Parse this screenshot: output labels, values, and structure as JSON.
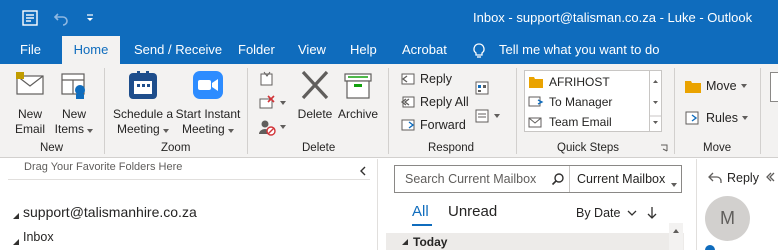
{
  "window": {
    "title": "Inbox - support@talisman.co.za - Luke  -  Outlook"
  },
  "tabs": [
    {
      "label": "File"
    },
    {
      "label": "Home"
    },
    {
      "label": "Send / Receive"
    },
    {
      "label": "Folder"
    },
    {
      "label": "View"
    },
    {
      "label": "Help"
    },
    {
      "label": "Acrobat"
    }
  ],
  "tell_me": "Tell me what you want to do",
  "ribbon": {
    "new": {
      "new_email": [
        "New",
        "Email"
      ],
      "new_items": [
        "New",
        "Items"
      ],
      "label": "New"
    },
    "zoom": {
      "schedule": [
        "Schedule a",
        "Meeting"
      ],
      "instant": [
        "Start Instant",
        "Meeting"
      ],
      "label": "Zoom"
    },
    "delete": {
      "delete_label": "Delete",
      "archive_label": "Archive",
      "label": "Delete"
    },
    "respond": {
      "reply": "Reply",
      "reply_all": "Reply All",
      "forward": "Forward",
      "label": "Respond"
    },
    "quick_steps": {
      "items": [
        "AFRIHOST",
        "To Manager",
        "Team Email"
      ],
      "label": "Quick Steps"
    },
    "move": {
      "move_label": "Move",
      "rules_label": "Rules",
      "label": "Move"
    }
  },
  "folder_pane": {
    "drag_hint": "Drag Your Favorite Folders Here",
    "account": "support@talismanhire.co.za",
    "inbox": "Inbox"
  },
  "mail_list": {
    "search_placeholder": "Search Current Mailbox",
    "scope": "Current Mailbox",
    "filter_all": "All",
    "filter_unread": "Unread",
    "sort": "By Date",
    "group_today": "Today"
  },
  "reading_pane": {
    "reply": "Reply",
    "avatar_initial": "M"
  },
  "colors": {
    "accent": "#0F6CBD",
    "ribbon_bg": "#F3F2F1",
    "zoom_blue": "#2D8CFF"
  }
}
